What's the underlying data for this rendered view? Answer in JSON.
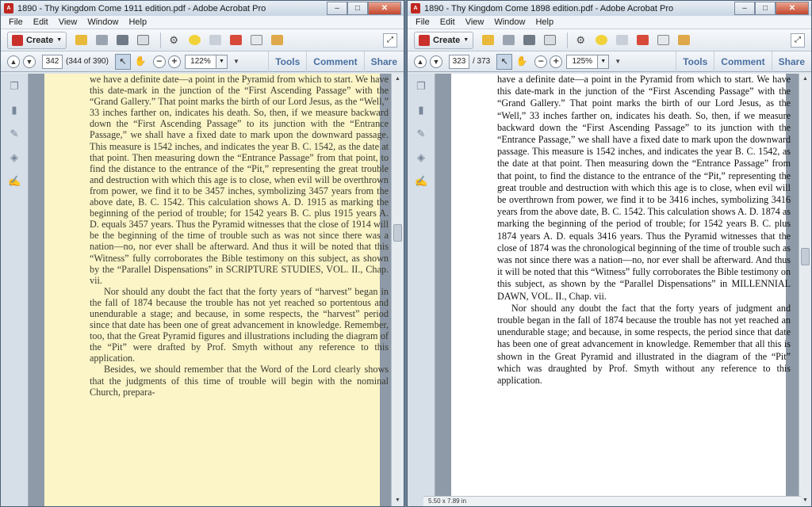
{
  "left_window": {
    "title": "1890 - Thy Kingdom Come 1911 edition.pdf - Adobe Acrobat Pro",
    "menu": [
      "File",
      "Edit",
      "View",
      "Window",
      "Help"
    ],
    "create_label": "Create",
    "page_number": "342",
    "page_count": "(344 of 390)",
    "zoom": "122%",
    "panels": [
      "Tools",
      "Comment",
      "Share"
    ],
    "page_text": "we have a definite date—a point in the Pyramid from which to start. We have this date-mark in the junction of the “First Ascending Passage” with the “Grand Gallery.” That point marks the birth of our Lord Jesus, as the “Well,” 33 inches farther on, indicates his death. So, then, if we measure backward down the “First Ascending Passage” to its junction with the “Entrance Passage,” we shall have a fixed date to mark upon the downward passage. This measure is 1542 inches, and indicates the year B. C. 1542, as the date at that point. Then measuring down the “Entrance Passage” from that point, to find the distance to the entrance of the “Pit,” representing the great trouble and destruction with which this age is to close, when evil will be overthrown from power, we find it to be 3457 inches, symbolizing 3457 years from the above date, B. C. 1542. This calculation shows A. D. 1915 as marking the beginning of the period of trouble; for 1542 years B. C. plus 1915 years A. D. equals 3457 years. Thus the Pyramid witnesses that the close of 1914 will be the beginning of the time of trouble such as was not since there was a nation—no, nor ever shall be afterward. And thus it will be noted that this “Witness” fully corroborates the Bible testimony on this subject, as shown by the “Parallel Dispensations” in SCRIPTURE STUDIES, VOL. II., Chap. vii.",
    "page_text_2": "Nor should any doubt the fact that the forty years of “harvest” began in the fall of 1874 because the trouble has not yet reached so portentous and unendurable a stage; and because, in some respects, the “harvest” period since that date has been one of great advancement in knowledge. Remember, too, that the Great Pyramid figures and illustrations including the diagram of the “Pit” were drafted by Prof. Smyth without any reference to this application.",
    "page_text_3": "Besides, we should remember that the Word of the Lord clearly shows that the judgments of this time of trouble will begin with the nominal Church, prepara-"
  },
  "right_window": {
    "title": "1890 - Thy Kingdom Come 1898 edition.pdf - Adobe Acrobat Pro",
    "menu": [
      "File",
      "Edit",
      "View",
      "Window",
      "Help"
    ],
    "create_label": "Create",
    "page_number": "323",
    "page_count": "/ 373",
    "zoom": "125%",
    "panels": [
      "Tools",
      "Comment",
      "Share"
    ],
    "page_size": "5.50 x 7.89 in",
    "page_text": "have a definite date—a point in the Pyramid from which to start. We have this date-mark in the junction of the “First Ascending Passage” with the “Grand Gallery.” That point marks the birth of our Lord Jesus, as the “Well,” 33 inches farther on, indicates his death. So, then, if we measure backward down the “First Ascending Passage” to its junction with the “Entrance Passage,” we shall have a fixed date to mark upon the downward passage. This measure is 1542 inches, and indicates the year B. C. 1542, as the date at that point. Then measuring down the “Entrance Passage” from that point, to find the distance to the entrance of the “Pit,” representing the great trouble and destruction with which this age is to close, when evil will be overthrown from power, we find it to be 3416 inches, symbolizing 3416 years from the above date, B. C. 1542. This calculation shows A. D. 1874 as marking the beginning of the period of trouble; for 1542 years B. C. plus 1874 years A. D. equals 3416 years. Thus the Pyramid witnesses that the close of 1874 was the chronological beginning of the time of trouble such as was not since there was a nation—no, nor ever shall be afterward. And thus it will be noted that this “Witness” fully corroborates the Bible testimony on this subject, as shown by the “Parallel Dispensations” in MILLENNIAL DAWN, VOL. II., Chap. vii.",
    "page_text_2": "Nor should any doubt the fact that the forty years of judgment and trouble began in the fall of 1874 because the trouble has not yet reached an unendurable stage; and because, in some respects, the period since that date has been one of great advancement in knowledge. Remember that all this is shown in the Great Pyramid and illustrated in the diagram of the “Pit” which was draughted by Prof. Smyth without any reference to this application."
  },
  "colors": {
    "left_page_bg": "#fbf5c8",
    "right_page_bg": "#ffffff",
    "doc_bg": "#8e9aa8",
    "panel_link": "#4a6fa0"
  }
}
